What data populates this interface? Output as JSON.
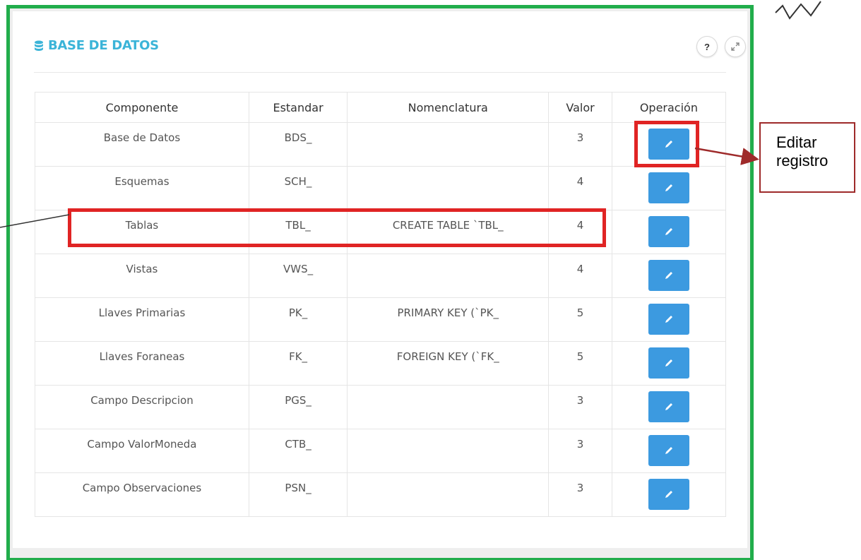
{
  "panel": {
    "title": "BASE DE DATOS",
    "help_label": "?",
    "icons": {
      "title_icon": "database-icon",
      "help": "question-icon",
      "expand": "expand-icon",
      "edit": "pencil-icon"
    }
  },
  "table": {
    "headers": {
      "componente": "Componente",
      "estandar": "Estandar",
      "nomenclatura": "Nomenclatura",
      "valor": "Valor",
      "operacion": "Operación"
    },
    "rows": [
      {
        "componente": "Base de Datos",
        "estandar": "BDS_",
        "nomenclatura": "",
        "valor": "3"
      },
      {
        "componente": "Esquemas",
        "estandar": "SCH_",
        "nomenclatura": "",
        "valor": "4"
      },
      {
        "componente": "Tablas",
        "estandar": "TBL_",
        "nomenclatura": "CREATE TABLE `TBL_",
        "valor": "4"
      },
      {
        "componente": "Vistas",
        "estandar": "VWS_",
        "nomenclatura": "",
        "valor": "4"
      },
      {
        "componente": "Llaves Primarias",
        "estandar": "PK_",
        "nomenclatura": "PRIMARY KEY (`PK_",
        "valor": "5"
      },
      {
        "componente": "Llaves Foraneas",
        "estandar": "FK_",
        "nomenclatura": "FOREIGN KEY (`FK_",
        "valor": "5"
      },
      {
        "componente": "Campo Descripcion",
        "estandar": "PGS_",
        "nomenclatura": "",
        "valor": "3"
      },
      {
        "componente": "Campo ValorMoneda",
        "estandar": "CTB_",
        "nomenclatura": "",
        "valor": "3"
      },
      {
        "componente": "Campo Observaciones",
        "estandar": "PSN_",
        "nomenclatura": "",
        "valor": "3"
      }
    ]
  },
  "callout": {
    "line1": "Editar",
    "line2": "registro"
  },
  "colors": {
    "frame_green": "#21ad4b",
    "title_blue": "#3bb4d8",
    "button_blue": "#3c9ae0",
    "highlight_red": "#e02424",
    "callout_border": "#9e2a2a"
  }
}
